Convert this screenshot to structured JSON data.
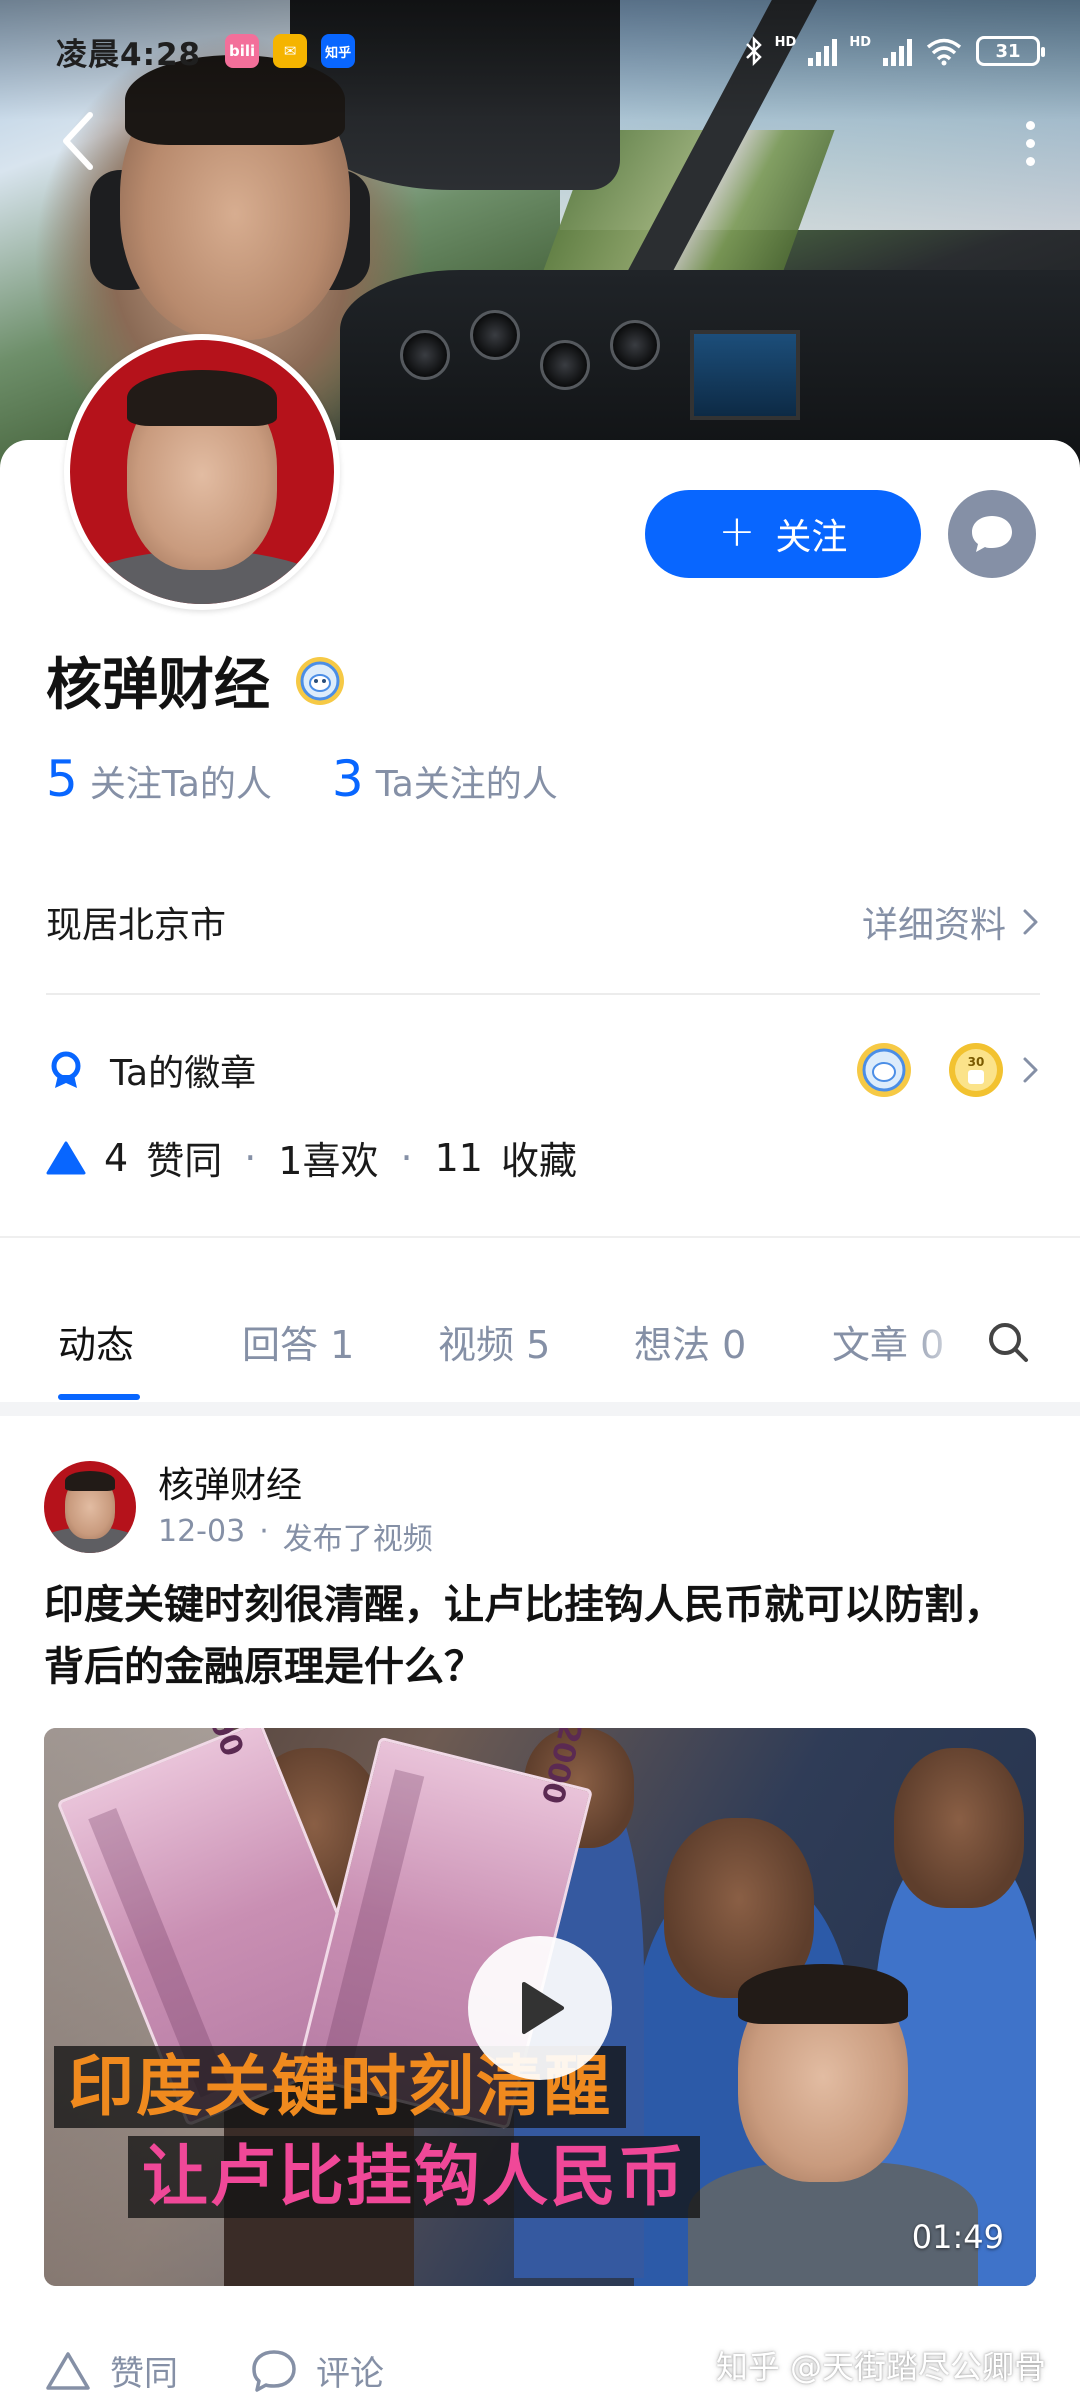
{
  "status_bar": {
    "time": "凌晨4:28",
    "apps": [
      {
        "name": "bilibili-app-icon",
        "label": "bili",
        "color": "#f36f9a"
      },
      {
        "name": "mail-app-icon",
        "label": "✉",
        "color": "#f5b400"
      },
      {
        "name": "zhihu-app-icon",
        "label": "知乎",
        "color": "#0866ff"
      }
    ],
    "battery": "31"
  },
  "profile": {
    "name": "核弹财经",
    "follow_button": "关注",
    "followers_count": "5",
    "followers_label": "关注Ta的人",
    "following_count": "3",
    "following_label": "Ta关注的人",
    "location": "现居北京市",
    "detail_link": "详细资料",
    "badges_label": "Ta的徽章",
    "likes_count": "4",
    "likes_label": "赞同",
    "favorites_text": "1喜欢",
    "collections_count": "11",
    "collections_label": "收藏",
    "separator": "·"
  },
  "tabs": [
    {
      "label": "动态"
    },
    {
      "label": "回答 1"
    },
    {
      "label": "视频 5"
    },
    {
      "label": "想法 0"
    },
    {
      "label": "文章 0"
    }
  ],
  "post": {
    "author": "核弹财经",
    "date": "12-03",
    "action": "发布了视频",
    "separator": "·",
    "title": "印度关键时刻很清醒，让卢比挂钩人民币就可以防割，背后的金融原理是什么？",
    "video_caption_line1": "印度关键时刻清醒",
    "video_caption_line2": "让卢比挂钩人民币",
    "banknote_value": "2000",
    "duration": "01:49",
    "like_label": "赞同",
    "comment_label": "评论"
  },
  "watermark": "知乎 @天街踏尽公卿骨",
  "colors": {
    "accent": "#0866ff",
    "muted": "#8590a6",
    "avatar_bg": "#b5121b"
  }
}
